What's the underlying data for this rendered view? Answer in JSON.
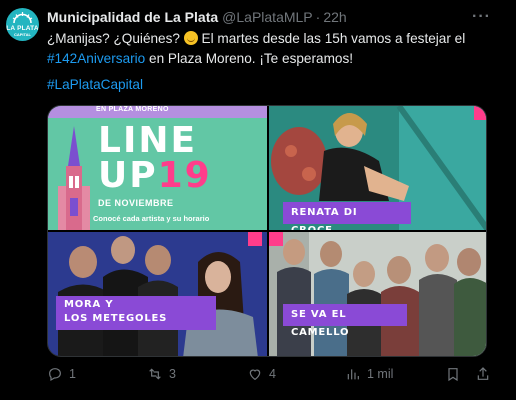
{
  "tweet": {
    "author_name": "Municipalidad de La Plata",
    "handle": "@LaPlataMLP",
    "separator": "·",
    "time": "22h",
    "avatar_line1": "LA PLATA",
    "avatar_line2": "CAPITAL",
    "text_part1": "¿Manijas? ¿Quiénes? ",
    "text_part2": " El martes desde las 15h vamos a festejar el ",
    "hashtag1": "#142Aniversario",
    "text_part3": " en Plaza Moreno. ¡Te esperamos!",
    "hashtag2": "#LaPlataCapital",
    "emoji": "smiling-face-icon"
  },
  "media": {
    "poster": {
      "strip_text": "EN PLAZA MORENO",
      "line1": "LINE",
      "line2": "UP",
      "number": "19",
      "date": "DE NOVIEMBRE",
      "cta": "Conocé cada artista y su horario"
    },
    "artists": [
      {
        "label": "RENATA DI CROCE"
      },
      {
        "label_line1": "MORA Y",
        "label_line2": "LOS METEGOLES"
      },
      {
        "label": "SE VA EL CAMELLO"
      }
    ]
  },
  "actions": {
    "replies": "1",
    "reposts": "3",
    "likes": "4",
    "views": "1 mil"
  },
  "colors": {
    "link": "#1d9bf0",
    "muted": "#71767b",
    "accent_pink": "#ff3d8b",
    "label_purple": "#8a4ad6"
  }
}
